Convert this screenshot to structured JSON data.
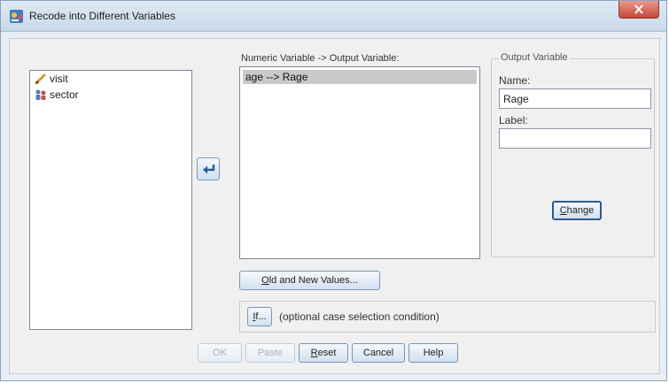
{
  "window": {
    "title": "Recode into Different Variables"
  },
  "source_variables": [
    {
      "name": "visit",
      "icon": "scale-ruler-icon"
    },
    {
      "name": "sector",
      "icon": "nominal-people-icon"
    }
  ],
  "target": {
    "label": "Numeric Variable -> Output Variable:",
    "items": [
      "age --> Rage"
    ]
  },
  "output": {
    "group_title": "Output Variable",
    "name_label": "Name:",
    "name_value": "Rage",
    "label_label": "Label:",
    "label_value": "",
    "change_button": "Change"
  },
  "buttons": {
    "old_new_values": "Old and New Values...",
    "if": "If...",
    "if_caption": "(optional case selection condition)",
    "ok": "OK",
    "paste": "Paste",
    "reset": "Reset",
    "cancel": "Cancel",
    "help": "Help"
  },
  "colors": {
    "selection": "#c9c9c9",
    "button_border": "#7996b4",
    "close_button": "#c6473a"
  }
}
